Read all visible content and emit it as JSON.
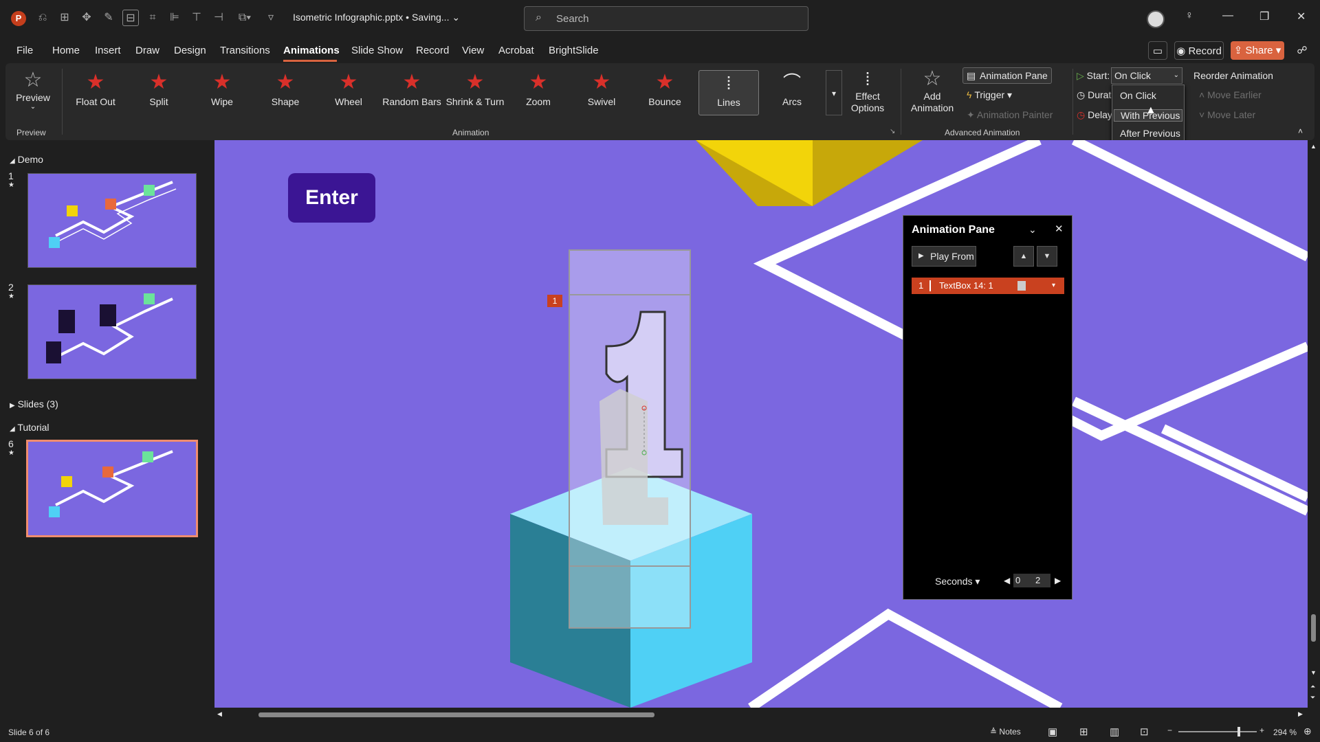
{
  "titlebar": {
    "app_logo": "P",
    "doc_title": "Isometric Infographic.pptx • Saving...",
    "search_placeholder": "Search",
    "icons": [
      "undo-icon",
      "redo-icon",
      "transform-icon",
      "pen-icon",
      "align-icon",
      "crop-icon",
      "align-left-icon",
      "text-direction-icon",
      "align-right-icon",
      "group-icon",
      "customize-qat-icon"
    ],
    "window_controls": [
      "minimize-icon",
      "restore-icon",
      "close-icon"
    ]
  },
  "menu": {
    "items": [
      "File",
      "Home",
      "Insert",
      "Draw",
      "Design",
      "Transitions",
      "Animations",
      "Slide Show",
      "Record",
      "View",
      "Acrobat",
      "BrightSlide"
    ],
    "active": "Animations",
    "record_label": "Record",
    "share_label": "Share"
  },
  "ribbon": {
    "preview_label": "Preview",
    "preview_group": "Preview",
    "animations": [
      "Float Out",
      "Split",
      "Wipe",
      "Shape",
      "Wheel",
      "Random Bars",
      "Shrink & Turn",
      "Zoom",
      "Swivel",
      "Bounce",
      "Lines",
      "Arcs"
    ],
    "selected_animation": "Lines",
    "effect_options": "Effect Options",
    "animation_group": "Animation",
    "add_animation": "Add Animation",
    "animation_pane": "Animation Pane",
    "trigger": "Trigger",
    "animation_painter": "Animation Painter",
    "advanced_group": "Advanced Animation",
    "start_label": "Start:",
    "start_value": "On Click",
    "duration_label": "Durati",
    "delay_label": "Delay:",
    "reorder": "Reorder Animation",
    "move_earlier": "Move Earlier",
    "move_later": "Move Later"
  },
  "start_dropdown": {
    "options": [
      "On Click",
      "With Previous",
      "After Previous"
    ],
    "hovered": "With Previous"
  },
  "slides_panel": {
    "sections": [
      {
        "name": "Demo",
        "expanded": true
      },
      {
        "name": "Slides (3)",
        "expanded": false
      },
      {
        "name": "Tutorial",
        "expanded": true
      }
    ],
    "slides": [
      {
        "number": "1",
        "star": "★"
      },
      {
        "number": "2",
        "star": "★"
      },
      {
        "number": "6",
        "star": "★",
        "selected": true
      }
    ]
  },
  "slide": {
    "enter_label": "Enter",
    "animation_marker": "1"
  },
  "animation_pane": {
    "title": "Animation Pane",
    "play_from": "Play From",
    "items": [
      {
        "index": "1",
        "name": "TextBox 14: 1"
      }
    ],
    "seconds_label": "Seconds",
    "timeline_start": "0",
    "timeline_end": "2"
  },
  "statusbar": {
    "slide_info": "Slide 6 of 6",
    "notes_label": "Notes",
    "zoom": "294 %"
  },
  "colors": {
    "slide_bg": "#7b67e0",
    "accent": "#d9633f",
    "animation_star": "#d9302a",
    "cube_light": "#4fd0f5",
    "cube_dark": "#2a7f95",
    "yellow": "#f2d40a",
    "enter_button": "#3b1594"
  }
}
